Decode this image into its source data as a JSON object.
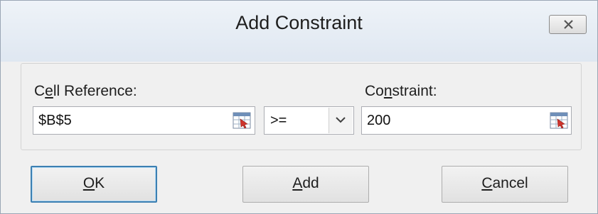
{
  "window": {
    "title": "Add Constraint"
  },
  "form": {
    "cell_reference": {
      "label_before": "C",
      "label_accel": "e",
      "label_after": "ll Reference:",
      "value": "$B$5"
    },
    "operator": {
      "selected": ">="
    },
    "constraint": {
      "label_before": "Co",
      "label_accel": "n",
      "label_after": "straint:",
      "value": "200"
    }
  },
  "buttons": {
    "ok": {
      "accel": "O",
      "rest": "K"
    },
    "add": {
      "accel": "A",
      "rest": "dd"
    },
    "cancel": {
      "accel": "C",
      "rest": "ancel"
    }
  },
  "icons": {
    "close": "close-icon",
    "collapse": "range-selector-icon",
    "dropdown": "chevron-down-icon"
  },
  "colors": {
    "default_button_border": "#3c7fb1",
    "titlebar": "#e6edf5",
    "window_bg": "#f0f0f0"
  }
}
